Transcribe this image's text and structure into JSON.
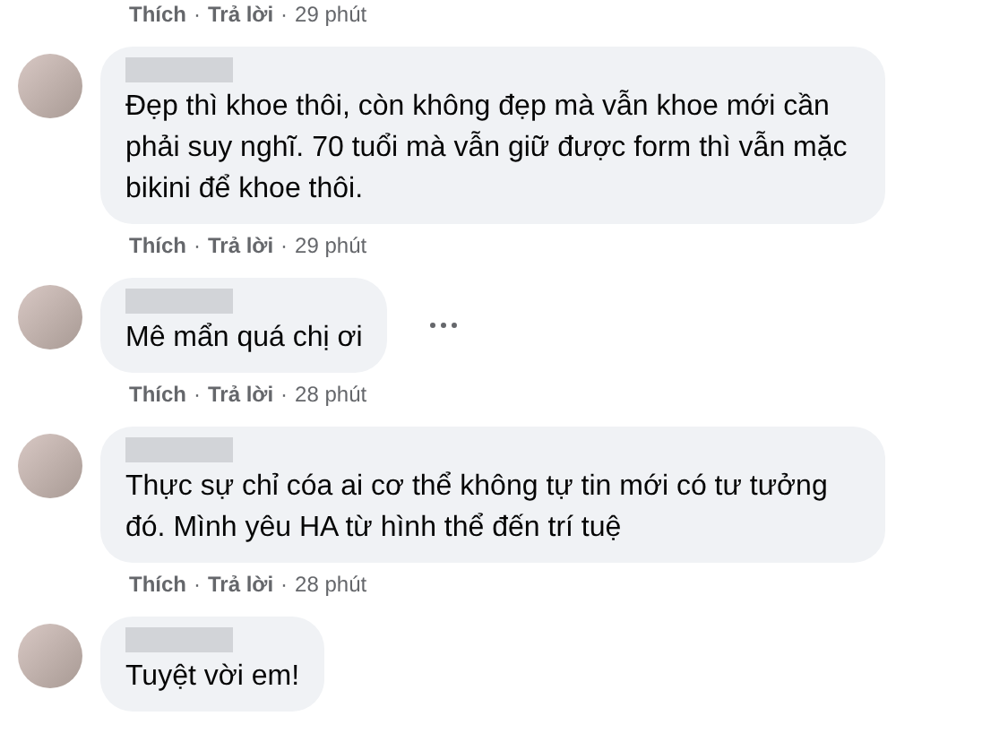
{
  "top_actions": {
    "like": "Thích",
    "reply": "Trả lời",
    "time": "29 phút",
    "separator": "·"
  },
  "comments": [
    {
      "text": "Đẹp thì khoe thôi, còn không đẹp mà vẫn khoe mới cần phải suy nghĩ. 70 tuổi mà vẫn giữ được form thì vẫn mặc bikini để khoe thôi.",
      "more_menu": false,
      "actions": {
        "like": "Thích",
        "reply": "Trả lời",
        "time": "29 phút",
        "separator": "·"
      }
    },
    {
      "text": "Mê mẩn quá chị ơi",
      "more_menu": true,
      "actions": {
        "like": "Thích",
        "reply": "Trả lời",
        "time": "28 phút",
        "separator": "·"
      }
    },
    {
      "text": "Thực sự chỉ cóa ai cơ thể không tự tin mới có tư tưởng đó. Mình yêu HA từ hình thể đến trí tuệ",
      "more_menu": false,
      "actions": {
        "like": "Thích",
        "reply": "Trả lời",
        "time": "28 phút",
        "separator": "·"
      }
    },
    {
      "text": "Tuyệt vời em!",
      "more_menu": false
    }
  ]
}
